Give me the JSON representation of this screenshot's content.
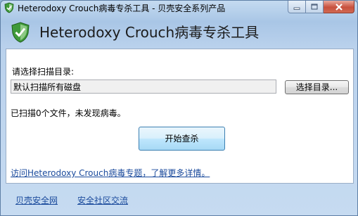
{
  "window": {
    "title": "Heterodoxy Crouch病毒专杀工具 - 贝壳安全系列产品",
    "icon": "shield-icon",
    "caption_buttons": [
      "minimize-icon",
      "maximize-icon",
      "close-icon"
    ]
  },
  "banner": {
    "title": "Heterodoxy Crouch病毒专杀工具",
    "logo": "shield-logo-icon"
  },
  "scan": {
    "directory_label": "请选择扫描目录:",
    "directory_value": "默认扫描所有磁盘",
    "browse_button": "选择目录...",
    "status": "已扫描0个文件，未发现病毒。",
    "start_button": "开始查杀",
    "topic_link": "访问Heterodoxy Crouch病毒专题，了解更多详情。"
  },
  "footer": {
    "links": [
      "贝壳安全网",
      "安全社区交流"
    ]
  },
  "colors": {
    "accent_green": "#3f9a3a",
    "link_blue": "#1a4a9c",
    "close_red": "#c7503d"
  }
}
